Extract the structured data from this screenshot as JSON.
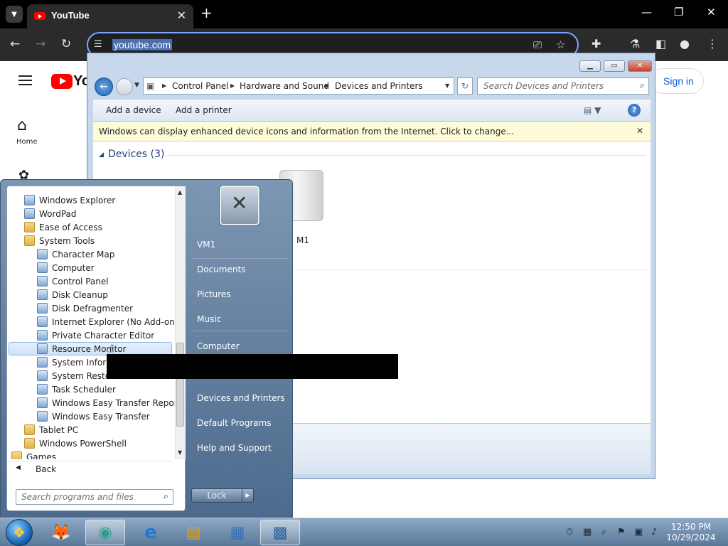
{
  "browser": {
    "tab_title": "YouTube",
    "url": "youtube.com",
    "tab_search_icon": "chevron-down-icon",
    "new_tab_glyph": "+",
    "close_glyph": "✕"
  },
  "youtube": {
    "logo_text": "Yo",
    "home_label": "Home",
    "sign_in": "Sign in"
  },
  "explorer": {
    "breadcrumbs": [
      "Control Panel",
      "Hardware and Sound",
      "Devices and Printers"
    ],
    "search_placeholder": "Search Devices and Printers",
    "commands": [
      "Add a device",
      "Add a printer"
    ],
    "info_bar": "Windows can display enhanced device icons and information from the Internet. Click to change...",
    "group_title": "Devices (3)",
    "device_label": "M1"
  },
  "start_menu": {
    "programs": [
      {
        "label": "Windows Explorer",
        "kind": "app",
        "indent": 1
      },
      {
        "label": "WordPad",
        "kind": "app",
        "indent": 1
      },
      {
        "label": "Ease of Access",
        "kind": "folder",
        "indent": 1
      },
      {
        "label": "System Tools",
        "kind": "folder",
        "indent": 1
      },
      {
        "label": "Character Map",
        "kind": "app",
        "indent": 2
      },
      {
        "label": "Computer",
        "kind": "app",
        "indent": 2
      },
      {
        "label": "Control Panel",
        "kind": "app",
        "indent": 2
      },
      {
        "label": "Disk Cleanup",
        "kind": "app",
        "indent": 2
      },
      {
        "label": "Disk Defragmenter",
        "kind": "app",
        "indent": 2
      },
      {
        "label": "Internet Explorer (No Add-ons)",
        "kind": "app",
        "indent": 2
      },
      {
        "label": "Private Character Editor",
        "kind": "app",
        "indent": 2
      },
      {
        "label": "Resource Monitor",
        "kind": "app",
        "indent": 2,
        "highlighted": true
      },
      {
        "label": "System Informa",
        "kind": "app",
        "indent": 2
      },
      {
        "label": "System Restore",
        "kind": "app",
        "indent": 2
      },
      {
        "label": "Task Scheduler",
        "kind": "app",
        "indent": 2
      },
      {
        "label": "Windows Easy Transfer Reports",
        "kind": "app",
        "indent": 2
      },
      {
        "label": "Windows Easy Transfer",
        "kind": "app",
        "indent": 2
      },
      {
        "label": "Tablet PC",
        "kind": "folder",
        "indent": 1
      },
      {
        "label": "Windows PowerShell",
        "kind": "folder",
        "indent": 1
      },
      {
        "label": "Games",
        "kind": "folder",
        "indent": 0
      }
    ],
    "back_label": "Back",
    "search_placeholder": "Search programs and files",
    "right_items": [
      "VM1",
      "Documents",
      "Pictures",
      "Music",
      "Computer",
      "Devices and Printers",
      "Default Programs",
      "Help and Support"
    ],
    "lock_label": "Lock"
  },
  "taskbar": {
    "items": [
      "firefox-icon",
      "app-icon",
      "internet-explorer-icon",
      "folder-icon",
      "document-icon",
      "control-panel-icon"
    ],
    "active_index": 1,
    "time": "12:50 PM",
    "date": "10/29/2024"
  }
}
